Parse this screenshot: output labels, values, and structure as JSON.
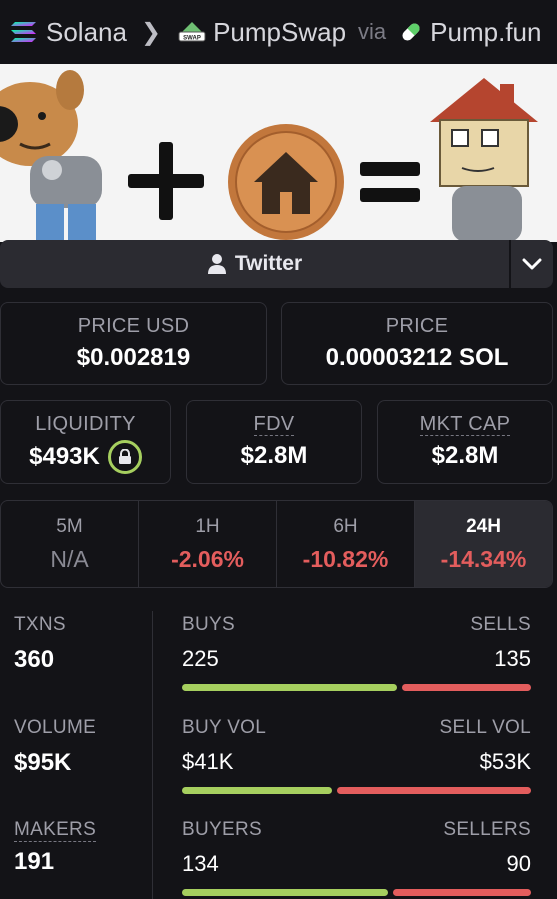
{
  "breadcrumb": {
    "chain": "Solana",
    "dex": "PumpSwap",
    "via": "via",
    "launchpad": "Pump.fun"
  },
  "dex_icon_text": "SWAP",
  "socials": {
    "twitter_label": "Twitter"
  },
  "stats": {
    "price_usd_label": "PRICE USD",
    "price_usd": "$0.002819",
    "price_label": "PRICE",
    "price": "0.00003212 SOL",
    "liquidity_label": "LIQUIDITY",
    "liquidity": "$493K",
    "fdv_label": "FDV",
    "fdv": "$2.8M",
    "mktcap_label": "MKT CAP",
    "mktcap": "$2.8M"
  },
  "timeframes": [
    {
      "label": "5M",
      "change": "N/A"
    },
    {
      "label": "1H",
      "change": "-2.06%"
    },
    {
      "label": "6H",
      "change": "-10.82%"
    },
    {
      "label": "24H",
      "change": "-14.34%",
      "active": true
    }
  ],
  "txns": {
    "txns_label": "TXNS",
    "txns": "360",
    "buys_label": "BUYS",
    "buys": "225",
    "sells_label": "SELLS",
    "sells": "135",
    "volume_label": "VOLUME",
    "volume": "$95K",
    "buy_vol_label": "BUY VOL",
    "buy_vol": "$41K",
    "sell_vol_label": "SELL VOL",
    "sell_vol": "$53K",
    "makers_label": "MAKERS",
    "makers": "191",
    "buyers_label": "BUYERS",
    "buyers": "134",
    "sellers_label": "SELLERS",
    "sellers": "90"
  },
  "ratios": {
    "buys_share": 0.625,
    "buy_vol_share": 0.436,
    "buyers_share": 0.598
  },
  "colors": {
    "positive": "#a6cf5f",
    "negative": "#e35d5d",
    "panel": "#2b2b31",
    "background": "#131317"
  }
}
